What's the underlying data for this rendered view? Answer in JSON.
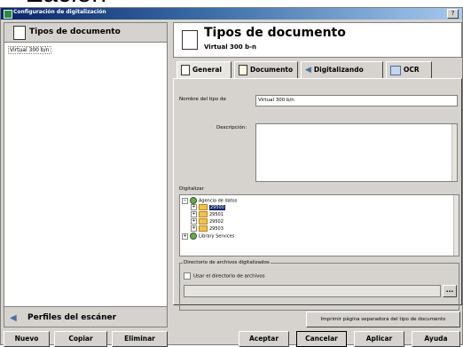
{
  "backdrop_text": "Zación",
  "window": {
    "title": "Configuración de digitalización",
    "help": "?"
  },
  "left": {
    "header": "Tipos de documento",
    "items": [
      "Virtual 300 b/n"
    ],
    "scanner_profiles": "Perfiles del escáner"
  },
  "right": {
    "title": "Tipos de documento",
    "subtitle": "Virtual 300 b-n",
    "tabs": [
      "General",
      "Documento",
      "Digitalizando",
      "OCR"
    ],
    "general": {
      "name_label": "Nombre del tipo de",
      "name_value": "Virtual 300 b/n",
      "description_label": "Descripción:",
      "description_value": "",
      "scanner_label": "Digitalizar",
      "tree": {
        "root": "Agencia de datos",
        "children": [
          "29500",
          "29501",
          "29502",
          "29503"
        ],
        "library": "Library Services"
      },
      "dir_group_label": "Directorio de archivos digitalizados",
      "use_dir_checkbox": "Usar el directorio de archivos",
      "browse_button": "..."
    },
    "print_separator": "Imprimir página separadora del tipo de documento"
  },
  "buttons": {
    "new": "Nuevo",
    "copy": "Copiar",
    "delete": "Eliminar",
    "accept": "Aceptar",
    "cancel": "Cancelar",
    "apply": "Aplicar",
    "help": "Ayuda"
  }
}
